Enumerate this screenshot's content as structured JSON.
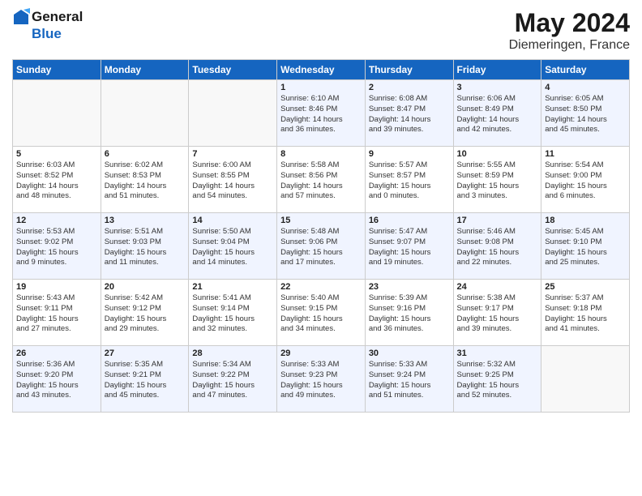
{
  "logo": {
    "general": "General",
    "blue": "Blue"
  },
  "title": "May 2024",
  "location": "Diemeringen, France",
  "days_of_week": [
    "Sunday",
    "Monday",
    "Tuesday",
    "Wednesday",
    "Thursday",
    "Friday",
    "Saturday"
  ],
  "weeks": [
    [
      {
        "day": "",
        "content": ""
      },
      {
        "day": "",
        "content": ""
      },
      {
        "day": "",
        "content": ""
      },
      {
        "day": "1",
        "content": "Sunrise: 6:10 AM\nSunset: 8:46 PM\nDaylight: 14 hours\nand 36 minutes."
      },
      {
        "day": "2",
        "content": "Sunrise: 6:08 AM\nSunset: 8:47 PM\nDaylight: 14 hours\nand 39 minutes."
      },
      {
        "day": "3",
        "content": "Sunrise: 6:06 AM\nSunset: 8:49 PM\nDaylight: 14 hours\nand 42 minutes."
      },
      {
        "day": "4",
        "content": "Sunrise: 6:05 AM\nSunset: 8:50 PM\nDaylight: 14 hours\nand 45 minutes."
      }
    ],
    [
      {
        "day": "5",
        "content": "Sunrise: 6:03 AM\nSunset: 8:52 PM\nDaylight: 14 hours\nand 48 minutes."
      },
      {
        "day": "6",
        "content": "Sunrise: 6:02 AM\nSunset: 8:53 PM\nDaylight: 14 hours\nand 51 minutes."
      },
      {
        "day": "7",
        "content": "Sunrise: 6:00 AM\nSunset: 8:55 PM\nDaylight: 14 hours\nand 54 minutes."
      },
      {
        "day": "8",
        "content": "Sunrise: 5:58 AM\nSunset: 8:56 PM\nDaylight: 14 hours\nand 57 minutes."
      },
      {
        "day": "9",
        "content": "Sunrise: 5:57 AM\nSunset: 8:57 PM\nDaylight: 15 hours\nand 0 minutes."
      },
      {
        "day": "10",
        "content": "Sunrise: 5:55 AM\nSunset: 8:59 PM\nDaylight: 15 hours\nand 3 minutes."
      },
      {
        "day": "11",
        "content": "Sunrise: 5:54 AM\nSunset: 9:00 PM\nDaylight: 15 hours\nand 6 minutes."
      }
    ],
    [
      {
        "day": "12",
        "content": "Sunrise: 5:53 AM\nSunset: 9:02 PM\nDaylight: 15 hours\nand 9 minutes."
      },
      {
        "day": "13",
        "content": "Sunrise: 5:51 AM\nSunset: 9:03 PM\nDaylight: 15 hours\nand 11 minutes."
      },
      {
        "day": "14",
        "content": "Sunrise: 5:50 AM\nSunset: 9:04 PM\nDaylight: 15 hours\nand 14 minutes."
      },
      {
        "day": "15",
        "content": "Sunrise: 5:48 AM\nSunset: 9:06 PM\nDaylight: 15 hours\nand 17 minutes."
      },
      {
        "day": "16",
        "content": "Sunrise: 5:47 AM\nSunset: 9:07 PM\nDaylight: 15 hours\nand 19 minutes."
      },
      {
        "day": "17",
        "content": "Sunrise: 5:46 AM\nSunset: 9:08 PM\nDaylight: 15 hours\nand 22 minutes."
      },
      {
        "day": "18",
        "content": "Sunrise: 5:45 AM\nSunset: 9:10 PM\nDaylight: 15 hours\nand 25 minutes."
      }
    ],
    [
      {
        "day": "19",
        "content": "Sunrise: 5:43 AM\nSunset: 9:11 PM\nDaylight: 15 hours\nand 27 minutes."
      },
      {
        "day": "20",
        "content": "Sunrise: 5:42 AM\nSunset: 9:12 PM\nDaylight: 15 hours\nand 29 minutes."
      },
      {
        "day": "21",
        "content": "Sunrise: 5:41 AM\nSunset: 9:14 PM\nDaylight: 15 hours\nand 32 minutes."
      },
      {
        "day": "22",
        "content": "Sunrise: 5:40 AM\nSunset: 9:15 PM\nDaylight: 15 hours\nand 34 minutes."
      },
      {
        "day": "23",
        "content": "Sunrise: 5:39 AM\nSunset: 9:16 PM\nDaylight: 15 hours\nand 36 minutes."
      },
      {
        "day": "24",
        "content": "Sunrise: 5:38 AM\nSunset: 9:17 PM\nDaylight: 15 hours\nand 39 minutes."
      },
      {
        "day": "25",
        "content": "Sunrise: 5:37 AM\nSunset: 9:18 PM\nDaylight: 15 hours\nand 41 minutes."
      }
    ],
    [
      {
        "day": "26",
        "content": "Sunrise: 5:36 AM\nSunset: 9:20 PM\nDaylight: 15 hours\nand 43 minutes."
      },
      {
        "day": "27",
        "content": "Sunrise: 5:35 AM\nSunset: 9:21 PM\nDaylight: 15 hours\nand 45 minutes."
      },
      {
        "day": "28",
        "content": "Sunrise: 5:34 AM\nSunset: 9:22 PM\nDaylight: 15 hours\nand 47 minutes."
      },
      {
        "day": "29",
        "content": "Sunrise: 5:33 AM\nSunset: 9:23 PM\nDaylight: 15 hours\nand 49 minutes."
      },
      {
        "day": "30",
        "content": "Sunrise: 5:33 AM\nSunset: 9:24 PM\nDaylight: 15 hours\nand 51 minutes."
      },
      {
        "day": "31",
        "content": "Sunrise: 5:32 AM\nSunset: 9:25 PM\nDaylight: 15 hours\nand 52 minutes."
      },
      {
        "day": "",
        "content": ""
      }
    ]
  ]
}
